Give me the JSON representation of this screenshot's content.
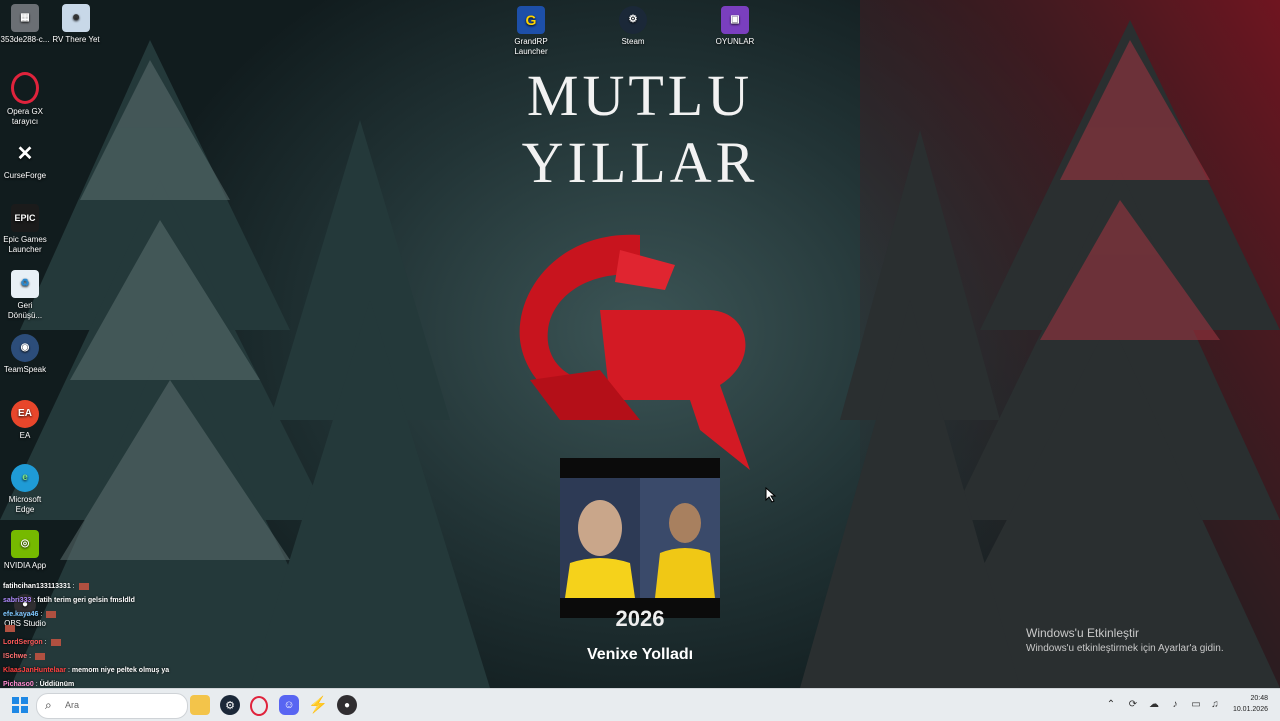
{
  "desktop": {
    "icons_left": [
      {
        "label": "353de288-c...",
        "icon": "file-icon",
        "color": "#6b6f74"
      },
      {
        "label": "RV There Yet",
        "icon": "game-icon",
        "color": "#c8d8e8"
      },
      {
        "label": "Opera GX tarayıcı",
        "icon": "opera-gx-icon",
        "color": "#e0233c"
      },
      {
        "label": "CurseForge",
        "icon": "curseforge-icon",
        "color": "#222222"
      },
      {
        "label": "Epic Games Launcher",
        "icon": "epic-games-icon",
        "color": "#1b1b1b"
      },
      {
        "label": "Geri Dönüşü...",
        "icon": "recycle-bin-icon",
        "color": "#e8f0f6"
      },
      {
        "label": "TeamSpeak",
        "icon": "teamspeak-icon",
        "color": "#2c4d7a"
      },
      {
        "label": "EA",
        "icon": "ea-icon",
        "color": "#e8462b"
      },
      {
        "label": "Microsoft Edge",
        "icon": "edge-icon",
        "color": "#1f9bd6"
      },
      {
        "label": "NVIDIA App",
        "icon": "nvidia-icon",
        "color": "#76b900"
      },
      {
        "label": "OBS Studio",
        "icon": "obs-icon",
        "color": "#302e31"
      }
    ],
    "icons_top": [
      {
        "label": "GrandRP Launcher",
        "icon": "grandrp-icon",
        "color": "#1d4fa8"
      },
      {
        "label": "Steam",
        "icon": "steam-icon",
        "color": "#1b2838"
      },
      {
        "label": "OYUNLAR",
        "icon": "games-folder-icon",
        "color": "#7a3fbf"
      }
    ],
    "title": "MUTLU YILLAR",
    "year": "2026",
    "sender": "Venixe Yolladı",
    "activation": {
      "line1": "Windows'u Etkinleştir",
      "line2": "Windows'u etkinleştirmek için Ayarlar'a gidin."
    }
  },
  "chat": [
    {
      "user": "fatihcihan133113331",
      "text": "",
      "user_color": "#ffffff"
    },
    {
      "user": "sabri333",
      "text": "fatih terim geri gelsin fmsldld",
      "user_color": "#b08cff"
    },
    {
      "user": "efe.kaya46",
      "text": "",
      "user_color": "#7fc8ff"
    },
    {
      "user": "",
      "text": "",
      "user_color": "#ff6a6a"
    },
    {
      "user": "LordSergon",
      "text": "",
      "user_color": "#ff5a5a"
    },
    {
      "user": "ISchwe",
      "text": "",
      "user_color": "#ff7070"
    },
    {
      "user": "KlaasJanHuntelaar",
      "text": "memom niye peltek olmuş ya",
      "user_color": "#ff4040"
    },
    {
      "user": "Pichaso0",
      "text": "Üddiünüm",
      "user_color": "#ff8ad0"
    }
  ],
  "taskbar": {
    "search_placeholder": "Ara",
    "time": "20:48",
    "date": "10.01.2026",
    "apps": [
      "file-explorer-icon",
      "steam-icon",
      "opera-gx-icon",
      "discord-icon",
      "flash-icon",
      "obs-icon"
    ]
  }
}
